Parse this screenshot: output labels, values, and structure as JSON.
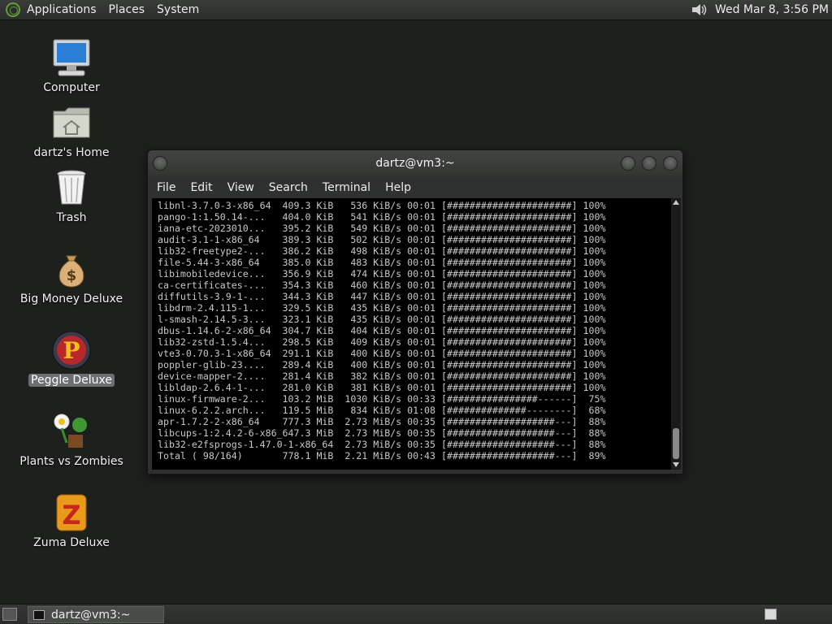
{
  "top_panel": {
    "menus": [
      "Applications",
      "Places",
      "System"
    ],
    "clock": "Wed Mar  8,  3:56 PM",
    "icons": [
      "distro-logo-icon",
      "volume-icon"
    ]
  },
  "desktop": {
    "icons": [
      {
        "label": "Computer",
        "icon": "computer-icon"
      },
      {
        "label": "dartz's Home",
        "icon": "home-folder-icon"
      },
      {
        "label": "Trash",
        "icon": "trash-icon"
      },
      {
        "label": "Big Money Deluxe",
        "icon": "money-bag-icon"
      },
      {
        "label": "Peggle Deluxe",
        "icon": "peggle-icon",
        "selected": true
      },
      {
        "label": "Plants vs Zombies",
        "icon": "plants-vs-zombies-icon"
      },
      {
        "label": "Zuma Deluxe",
        "icon": "zuma-icon"
      }
    ]
  },
  "terminal": {
    "title": "dartz@vm3:~",
    "menus": [
      "File",
      "Edit",
      "View",
      "Search",
      "Terminal",
      "Help"
    ],
    "lines": [
      "libnl-3.7.0-3-x86_64  409.3 KiB   536 KiB/s 00:01 [######################] 100%",
      "pango-1:1.50.14-...   404.0 KiB   541 KiB/s 00:01 [######################] 100%",
      "iana-etc-2023010...   395.2 KiB   549 KiB/s 00:01 [######################] 100%",
      "audit-3.1-1-x86_64    389.3 KiB   502 KiB/s 00:01 [######################] 100%",
      "lib32-freetype2-...   386.2 KiB   498 KiB/s 00:01 [######################] 100%",
      "file-5.44-3-x86_64    385.0 KiB   483 KiB/s 00:01 [######################] 100%",
      "libimobiledevice...   356.9 KiB   474 KiB/s 00:01 [######################] 100%",
      "ca-certificates-...   354.3 KiB   460 KiB/s 00:01 [######################] 100%",
      "diffutils-3.9-1-...   344.3 KiB   447 KiB/s 00:01 [######################] 100%",
      "libdrm-2.4.115-1...   329.5 KiB   435 KiB/s 00:01 [######################] 100%",
      "l-smash-2.14.5-3...   323.1 KiB   435 KiB/s 00:01 [######################] 100%",
      "dbus-1.14.6-2-x86_64  304.7 KiB   404 KiB/s 00:01 [######################] 100%",
      "lib32-zstd-1.5.4...   298.5 KiB   409 KiB/s 00:01 [######################] 100%",
      "vte3-0.70.3-1-x86_64  291.1 KiB   400 KiB/s 00:01 [######################] 100%",
      "poppler-glib-23....   289.4 KiB   400 KiB/s 00:01 [######################] 100%",
      "device-mapper-2....   281.4 KiB   382 KiB/s 00:01 [######################] 100%",
      "libldap-2.6.4-1-...   281.0 KiB   381 KiB/s 00:01 [######################] 100%",
      "linux-firmware-2...   103.2 MiB  1030 KiB/s 00:33 [################------]  75%",
      "linux-6.2.2.arch...   119.5 MiB   834 KiB/s 01:08 [##############--------]  68%",
      "apr-1.7.2-2-x86_64    777.3 MiB  2.73 MiB/s 00:35 [###################---]  88%",
      "libcups-1:2.4.2-6-x86_647.3 MiB  2.73 MiB/s 00:35 [###################---]  88%",
      "lib32-e2fsprogs-1.47.0-1-x86_64  2.73 MiB/s 00:35 [###################---]  88%",
      "Total ( 98/164)       778.1 MiB  2.21 MiB/s 00:43 [###################---]  89%"
    ]
  },
  "bottom_panel": {
    "task_label": "dartz@vm3:~",
    "icons": [
      "show-desktop-icon",
      "terminal-icon",
      "workspace-switcher-icon"
    ]
  }
}
